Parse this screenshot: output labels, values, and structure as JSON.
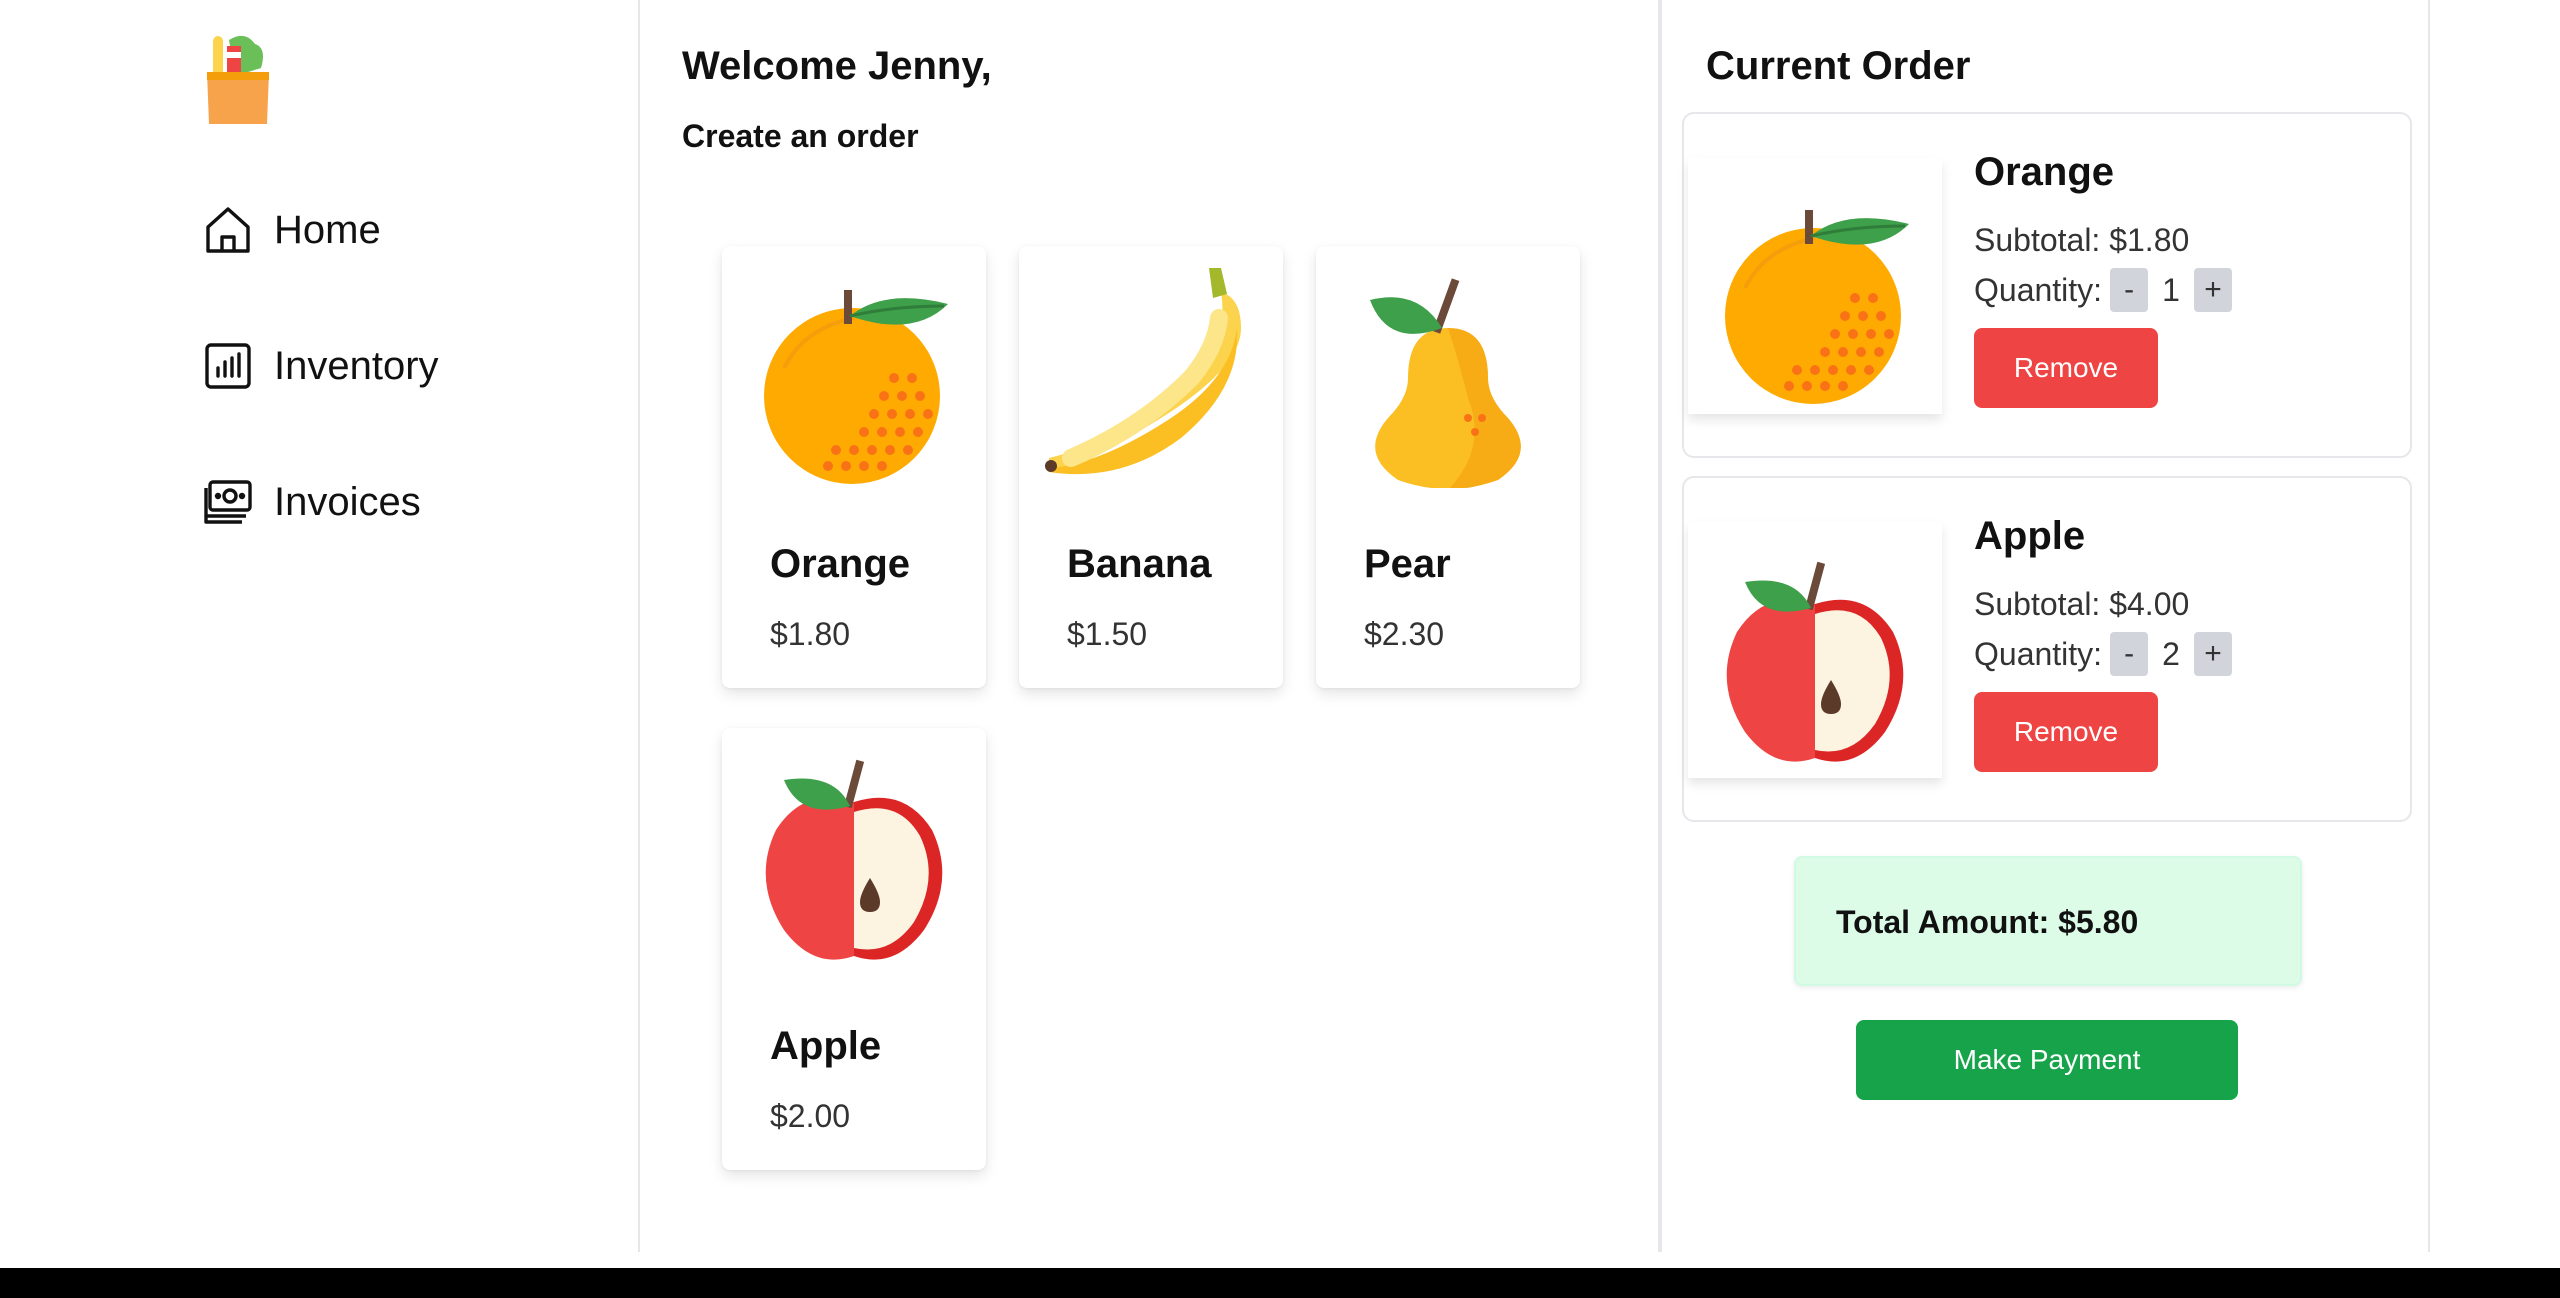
{
  "sidebar": {
    "logo_icon": "grocery-bag-icon",
    "items": [
      {
        "label": "Home",
        "icon": "home-icon"
      },
      {
        "label": "Inventory",
        "icon": "chart-icon"
      },
      {
        "label": "Invoices",
        "icon": "money-icon"
      }
    ]
  },
  "main": {
    "welcome": "Welcome Jenny,",
    "subtitle": "Create an order",
    "products": [
      {
        "name": "Orange",
        "price": "$1.80",
        "icon": "orange-icon"
      },
      {
        "name": "Banana",
        "price": "$1.50",
        "icon": "banana-icon"
      },
      {
        "name": "Pear",
        "price": "$2.30",
        "icon": "pear-icon"
      },
      {
        "name": "Apple",
        "price": "$2.00",
        "icon": "apple-icon"
      }
    ]
  },
  "order": {
    "title": "Current Order",
    "items": [
      {
        "name": "Orange",
        "subtotal": "Subtotal: $1.80",
        "quantity_label": "Quantity:",
        "quantity": "1",
        "minus": "-",
        "plus": "+",
        "remove_label": "Remove",
        "icon": "orange-icon"
      },
      {
        "name": "Apple",
        "subtotal": "Subtotal: $4.00",
        "quantity_label": "Quantity:",
        "quantity": "2",
        "minus": "-",
        "plus": "+",
        "remove_label": "Remove",
        "icon": "apple-icon"
      }
    ],
    "total": "Total Amount: $5.80",
    "pay_label": "Make Payment"
  },
  "colors": {
    "remove": "#ef4444",
    "pay": "#16a34a",
    "total_bg": "#dcfce7",
    "qty_btn": "#d1d5db"
  }
}
